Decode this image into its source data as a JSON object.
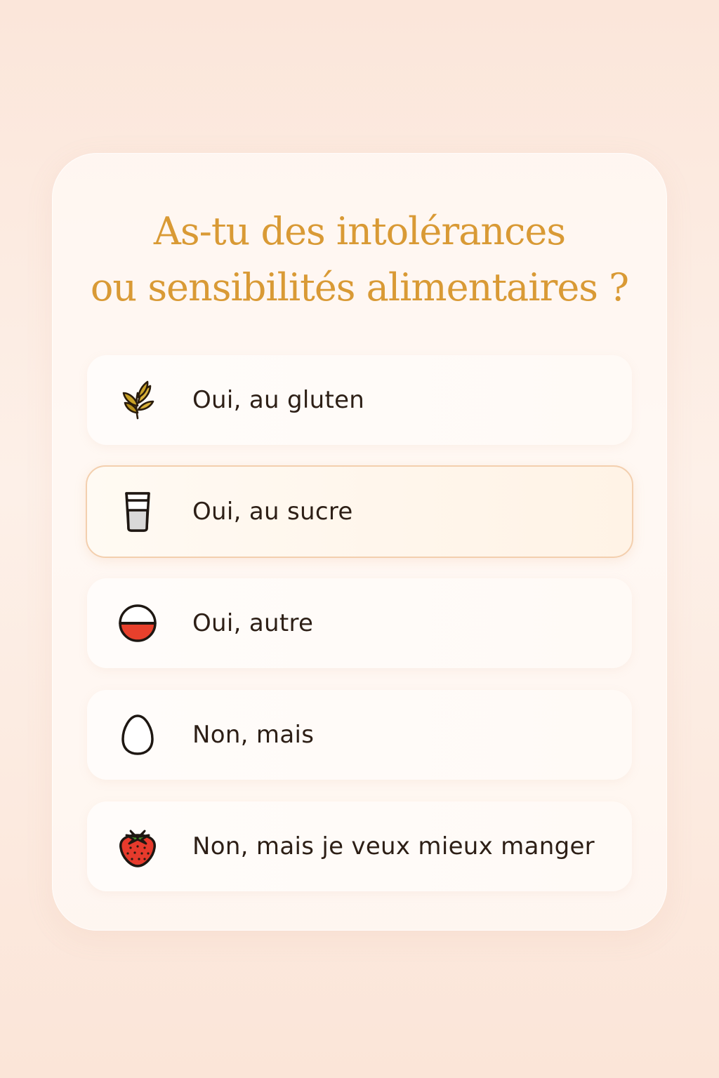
{
  "question": {
    "line1": "As-tu des intolérances",
    "line2": "ou sensibilités alimentaires ?"
  },
  "options": [
    {
      "label": "Oui, au gluten",
      "icon": "wheat-icon",
      "selected": false
    },
    {
      "label": "Oui, au sucre",
      "icon": "glass-icon",
      "selected": true
    },
    {
      "label": "Oui, autre",
      "icon": "bowl-icon",
      "selected": false
    },
    {
      "label": "Non, mais",
      "icon": "egg-icon",
      "selected": false
    },
    {
      "label": "Non, mais je veux mieux manger",
      "icon": "strawberry-icon",
      "selected": false
    }
  ],
  "colors": {
    "title": "#d99a35",
    "text": "#2d1f16",
    "selected_border": "#f3cfae",
    "background": "#fbe6da"
  }
}
